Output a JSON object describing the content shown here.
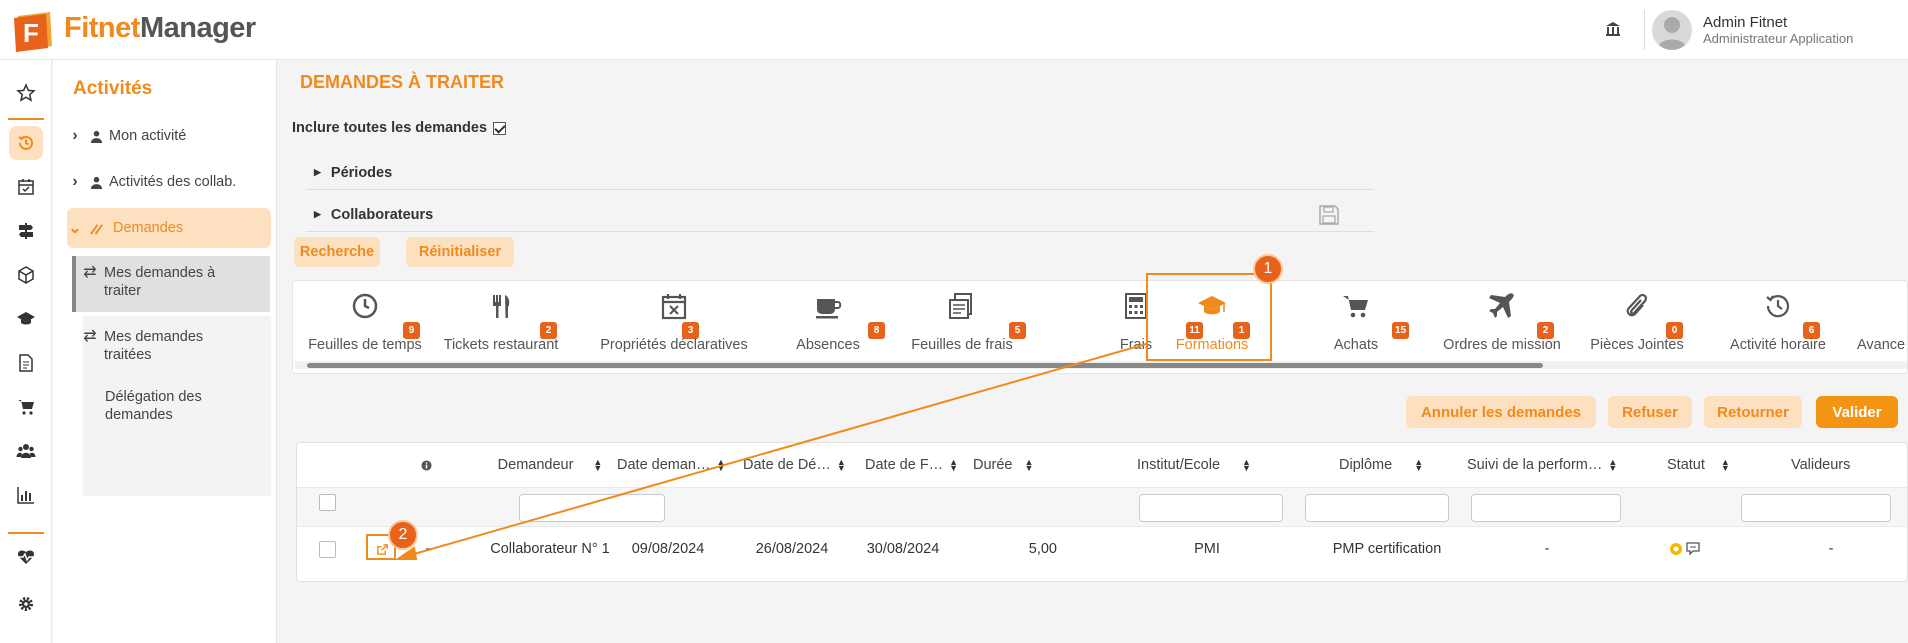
{
  "app": {
    "brand_part1": "Fitnet",
    "brand_part2": "Manager",
    "logo_letter": "F"
  },
  "user": {
    "name": "Admin Fitnet",
    "role": "Administrateur Application"
  },
  "iconbar": [
    "star-icon",
    "history-icon",
    "calendar-check-icon",
    "signpost-icon",
    "box-icon",
    "graduation-cap-icon",
    "document-icon",
    "cart-icon",
    "users-icon",
    "chart-bar-icon",
    "heart-pulse-icon",
    "gear-icon"
  ],
  "sidenav": {
    "title": "Activités",
    "items": [
      {
        "label": "Mon activité"
      },
      {
        "label": "Activités des collab."
      },
      {
        "label": "Demandes"
      }
    ],
    "sub_items": [
      {
        "label_line1": "Mes demandes à",
        "label_line2": "traiter"
      },
      {
        "label_line1": "Mes demandes",
        "label_line2": "traitées"
      },
      {
        "label_line1": "Délégation des",
        "label_line2": "demandes"
      }
    ]
  },
  "main": {
    "title": "DEMANDES À TRAITER",
    "include_all_label": "Inclure toutes les demandes",
    "include_all_checked": true,
    "accordions": [
      {
        "label": "Périodes"
      },
      {
        "label": "Collaborateurs"
      }
    ],
    "search_button": "Recherche",
    "reset_button": "Réinitialiser"
  },
  "tabs": [
    {
      "label": "Feuilles de temps",
      "count": "9",
      "icon": "clock-icon"
    },
    {
      "label": "Tickets restaurant",
      "count": "2",
      "icon": "fork-knife-icon"
    },
    {
      "label": "Propriétés déclaratives",
      "count": "3",
      "icon": "calendar-x-icon"
    },
    {
      "label": "Absences",
      "count": "8",
      "icon": "coffee-cup-icon"
    },
    {
      "label": "Feuilles de frais",
      "count": "5",
      "icon": "receipt-icon"
    },
    {
      "label": "Frais",
      "count": "11",
      "icon": "calculator-icon"
    },
    {
      "label": "Formations",
      "count": "1",
      "icon": "graduation-cap-icon",
      "selected": true
    },
    {
      "label": "Achats",
      "count": "15",
      "icon": "cart-icon"
    },
    {
      "label": "Ordres de mission",
      "count": "2",
      "icon": "plane-icon"
    },
    {
      "label": "Pièces Jointes",
      "count": "0",
      "icon": "paperclip-icon"
    },
    {
      "label": "Activité horaire",
      "count": "6",
      "icon": "clock-history-icon"
    },
    {
      "label": "Avance",
      "count": "",
      "icon": ""
    }
  ],
  "actions": {
    "cancel": "Annuler les demandes",
    "refuse": "Refuser",
    "return": "Retourner",
    "validate": "Valider"
  },
  "annotations": {
    "step1": "1",
    "step2": "2"
  },
  "table": {
    "headers": [
      "Demandeur",
      "Date deman…",
      "Date de Dé…",
      "Date de F…",
      "Durée",
      "Institut/Ecole",
      "Diplôme",
      "Suivi de la perform…",
      "Statut",
      "Valideurs"
    ],
    "rows": [
      {
        "info": "-",
        "demandeur": "Collaborateur N° 1",
        "date_demande": "09/08/2024",
        "date_debut": "26/08/2024",
        "date_fin": "30/08/2024",
        "duree": "5,00",
        "institut": "PMI",
        "diplome": "PMP certification",
        "suivi": "-",
        "valideurs": "-"
      }
    ]
  },
  "colors": {
    "accent": "#f08a1c",
    "accent_light": "#fde0bf",
    "badge": "#e7621a"
  }
}
